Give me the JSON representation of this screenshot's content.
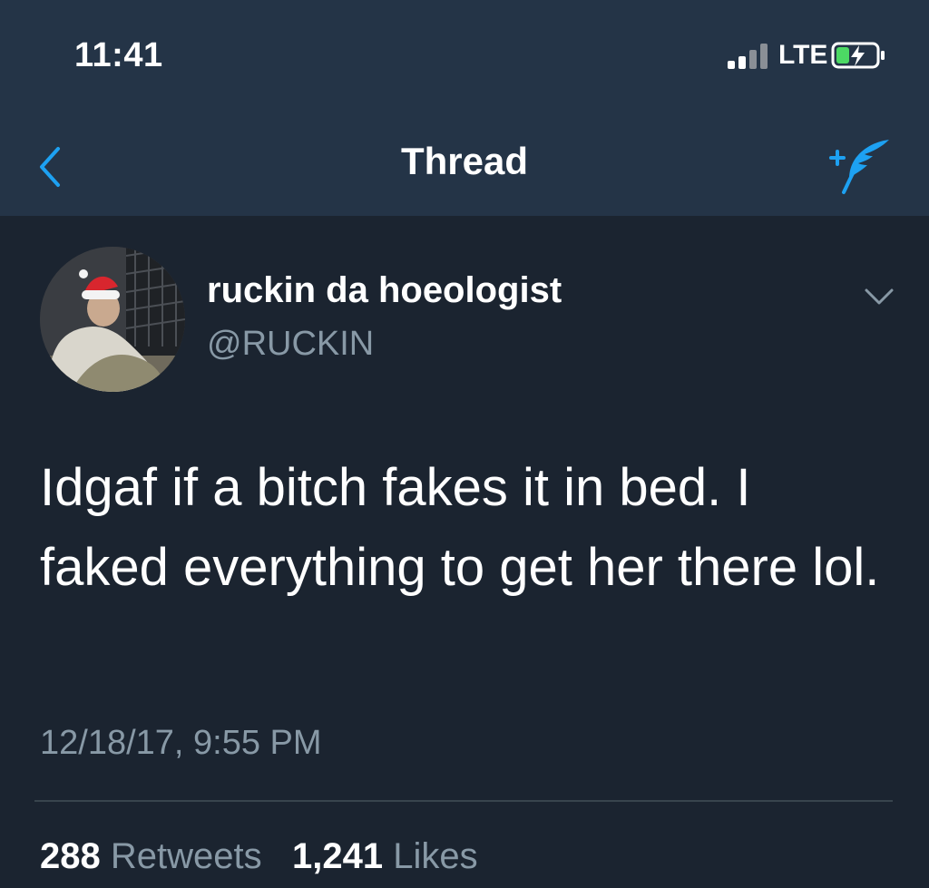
{
  "status_bar": {
    "time": "11:41",
    "carrier": "LTE"
  },
  "nav": {
    "title": "Thread",
    "back_icon": "chevron-left-icon",
    "compose_icon": "compose-tweet-icon",
    "accent_color": "#1da1f2"
  },
  "tweet": {
    "display_name": "ruckin da hoeologist",
    "handle": "@RUCKIN",
    "text": "Idgaf if a bitch fakes it in bed. I faked everything to get her there lol.",
    "timestamp": "12/18/17, 9:55 PM",
    "retweets_count": "288",
    "retweets_label": "Retweets",
    "likes_count": "1,241",
    "likes_label": "Likes"
  }
}
